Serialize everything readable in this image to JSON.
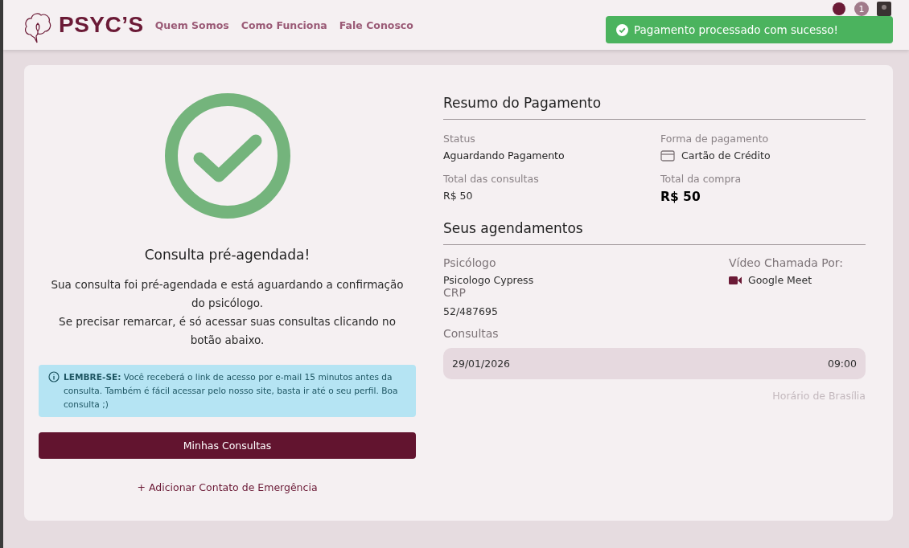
{
  "header": {
    "brand": "PSYC’S",
    "nav": [
      {
        "label": "Quem Somos"
      },
      {
        "label": "Como Funciona"
      },
      {
        "label": "Fale Conosco"
      }
    ],
    "notification_count": "1"
  },
  "toast": {
    "message": "Pagamento processado com sucesso!"
  },
  "confirmation": {
    "title": "Consulta pré-agendada!",
    "message": [
      "Sua consulta foi pré-agendada e está aguardando a confirmação do psicólogo.",
      "Se precisar remarcar, é só acessar suas consultas clicando no botão abaixo."
    ],
    "reminder": "**LEMBRE-SE:** Você receberá o link de acesso por e-mail 15 minutos antes da consulta. Também é fácil acessar pelo nosso site, basta ir até o seu perfil. Boa consulta ;)",
    "button": "Minhas Consultas",
    "link": "+ Adicionar Contato de Emergência"
  },
  "summary": {
    "title": "Resumo do Pagamento",
    "status_label": "Status",
    "status": "Aguardando Pagamento",
    "method_label": "Forma de pagamento",
    "method": "Cartão de Crédito",
    "subtotal_label": "Total das consultas",
    "subtotal": "R$ 50",
    "total_label": "Total da compra",
    "total": "R$ 50"
  },
  "appointments": {
    "title": "Seus agendamentos",
    "psychologist_label": "Psicólogo",
    "psychologist": "Psicologo Cypress",
    "video_label": "Vídeo Chamada Por:",
    "video": "Google Meet",
    "crp_label": "CRP",
    "crp": "52/487695",
    "sessions_label": "Consultas",
    "sessions": [
      {
        "date": "29/01/2026",
        "time": "09:00"
      }
    ],
    "timezone": "Horário de Brasília"
  }
}
